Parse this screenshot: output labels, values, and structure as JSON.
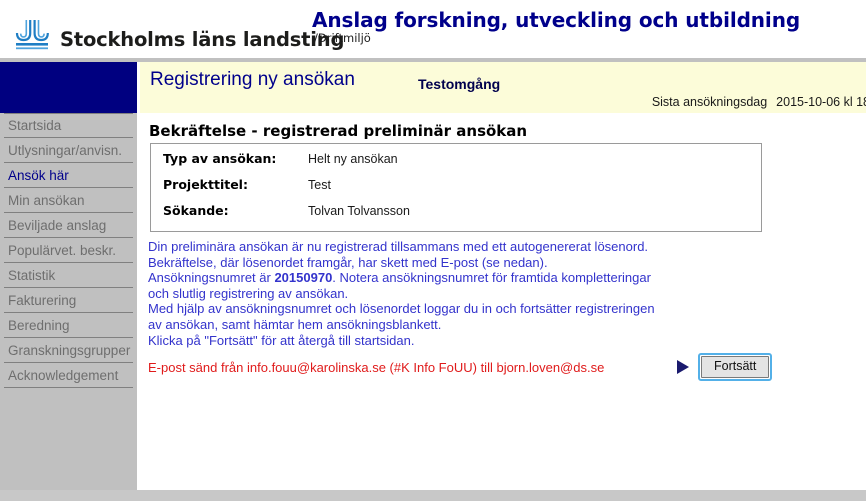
{
  "brand": {
    "logo_icon": "sll-logo-icon",
    "logo_text": "Stockholms läns landsting",
    "app_title": "Anslag forskning, utveckling och utbildning",
    "app_subtitle": "/Driftmiljö"
  },
  "sidebar": {
    "items": [
      {
        "label": "Startsida",
        "active": false
      },
      {
        "label": "Utlysningar/anvisn.",
        "active": false
      },
      {
        "label": "Ansök här",
        "active": true
      },
      {
        "label": "Min ansökan",
        "active": false
      },
      {
        "label": "Beviljade anslag",
        "active": false
      },
      {
        "label": "Populärvet. beskr.",
        "active": false
      },
      {
        "label": "Statistik",
        "active": false
      },
      {
        "label": "Fakturering",
        "active": false
      },
      {
        "label": "Beredning",
        "active": false
      },
      {
        "label": "Granskningsgrupper",
        "active": false
      },
      {
        "label": "Acknowledgement",
        "active": false
      }
    ]
  },
  "titlebar": {
    "heading": "Registrering ny ansökan",
    "round": "Testomgång",
    "deadline_label": "Sista ansökningsdag",
    "deadline_value": "2015-10-06 kl 18"
  },
  "main": {
    "section_heading": "Bekräftelse - registrerad preliminär ansökan",
    "info_rows": [
      {
        "label": "Typ av ansökan:",
        "value": "Helt ny ansökan"
      },
      {
        "label": "Projekttitel:",
        "value": "Test"
      },
      {
        "label": "Sökande:",
        "value": "Tolvan Tolvansson"
      }
    ],
    "notice": {
      "line1": "Din preliminära ansökan är nu registrerad tillsammans med ett autogenererat lösenord.",
      "line2": "Bekräftelse, där lösenordet framgår, har skett med E-post (se nedan).",
      "line3_pre": "Ansökningsnumret är ",
      "line3_number": "20150970",
      "line3_post": ". Notera ansökningsnumret för framtida kompletteringar",
      "line4": "och slutlig registrering av ansökan.",
      "line5": "Med hjälp av ansökningsnumret och lösenordet loggar du in och fortsätter registreringen",
      "line6": "av ansökan, samt hämtar hem ansökningsblankett.",
      "line7": "Klicka på \"Fortsätt\" för att återgå till startsidan.",
      "email_line": "E-post sänd från info.fouu@karolinska.se (#K Info FoUU) till bjorn.loven@ds.se"
    },
    "continue": {
      "arrow_icon": "play-arrow-icon",
      "label": "Fortsätt"
    }
  },
  "colors": {
    "navy": "#000080",
    "brand_blue": "#1f7ec4",
    "sidebar_grey": "#c0c0c0",
    "titlebar_yellow": "#fcfcd9",
    "notice_blue": "#3333cc",
    "email_red": "#e01b1b",
    "focus_ring": "#53b0e8"
  }
}
